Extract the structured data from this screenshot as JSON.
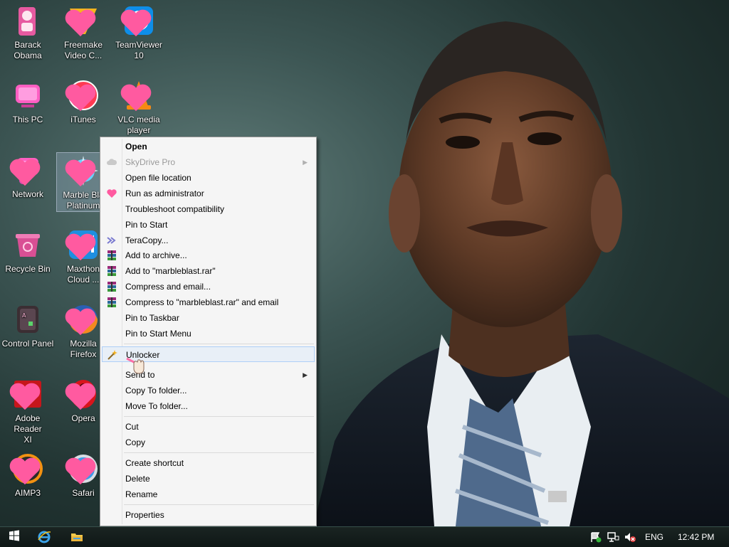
{
  "desktop": {
    "icons": [
      {
        "label_lines": [
          "Barack",
          "Obama"
        ],
        "icon": "user-folder-icon"
      },
      {
        "label_lines": [
          "Freemake",
          "Video C..."
        ],
        "icon": "freemake-icon"
      },
      {
        "label_lines": [
          "TeamViewer",
          "10"
        ],
        "icon": "teamviewer-icon"
      },
      {
        "label_lines": [
          "This PC",
          ""
        ],
        "icon": "computer-icon"
      },
      {
        "label_lines": [
          "iTunes",
          ""
        ],
        "icon": "itunes-icon"
      },
      {
        "label_lines": [
          "VLC media",
          "player"
        ],
        "icon": "vlc-icon"
      },
      {
        "label_lines": [
          "Network",
          ""
        ],
        "icon": "network-icon"
      },
      {
        "label_lines": [
          "Marble Bla",
          "Platinum"
        ],
        "icon": "marble-blast-icon"
      },
      {
        "label_lines": [
          "Recycle Bin",
          ""
        ],
        "icon": "recycle-bin-icon"
      },
      {
        "label_lines": [
          "Maxthon",
          "Cloud ..."
        ],
        "icon": "maxthon-icon"
      },
      {
        "label_lines": [
          "Control Panel",
          ""
        ],
        "icon": "control-panel-icon"
      },
      {
        "label_lines": [
          "Mozilla",
          "Firefox"
        ],
        "icon": "firefox-icon"
      },
      {
        "label_lines": [
          "Adobe Reader",
          "XI"
        ],
        "icon": "adobe-reader-icon"
      },
      {
        "label_lines": [
          "Opera",
          ""
        ],
        "icon": "opera-icon"
      },
      {
        "label_lines": [
          "AIMP3",
          ""
        ],
        "icon": "aimp-icon"
      },
      {
        "label_lines": [
          "Safari",
          ""
        ],
        "icon": "safari-icon"
      }
    ]
  },
  "context_menu": {
    "items": {
      "open": "Open",
      "skydrive": "SkyDrive Pro",
      "open_location": "Open file location",
      "run_admin": "Run as administrator",
      "troubleshoot": "Troubleshoot compatibility",
      "pin_start": "Pin to Start",
      "teracopy": "TeraCopy...",
      "add_archive": "Add to archive...",
      "add_rar": "Add to \"marbleblast.rar\"",
      "compress_email": "Compress and email...",
      "compress_rar_email": "Compress to \"marbleblast.rar\" and email",
      "pin_taskbar": "Pin to Taskbar",
      "pin_start_menu": "Pin to Start Menu",
      "unlocker": "Unlocker",
      "send_to": "Send to",
      "copy_to": "Copy To folder...",
      "move_to": "Move To folder...",
      "cut": "Cut",
      "copy": "Copy",
      "create_shortcut": "Create shortcut",
      "delete": "Delete",
      "rename": "Rename",
      "properties": "Properties"
    },
    "submenu_arrow": "▶"
  },
  "taskbar": {
    "language": "ENG",
    "clock": "12:42 PM"
  },
  "colors": {
    "menu_bg": "#f5f5f5",
    "menu_hover": "#e8eff7",
    "heart": "#ff5aa0",
    "taskbar": "#121c1b"
  }
}
